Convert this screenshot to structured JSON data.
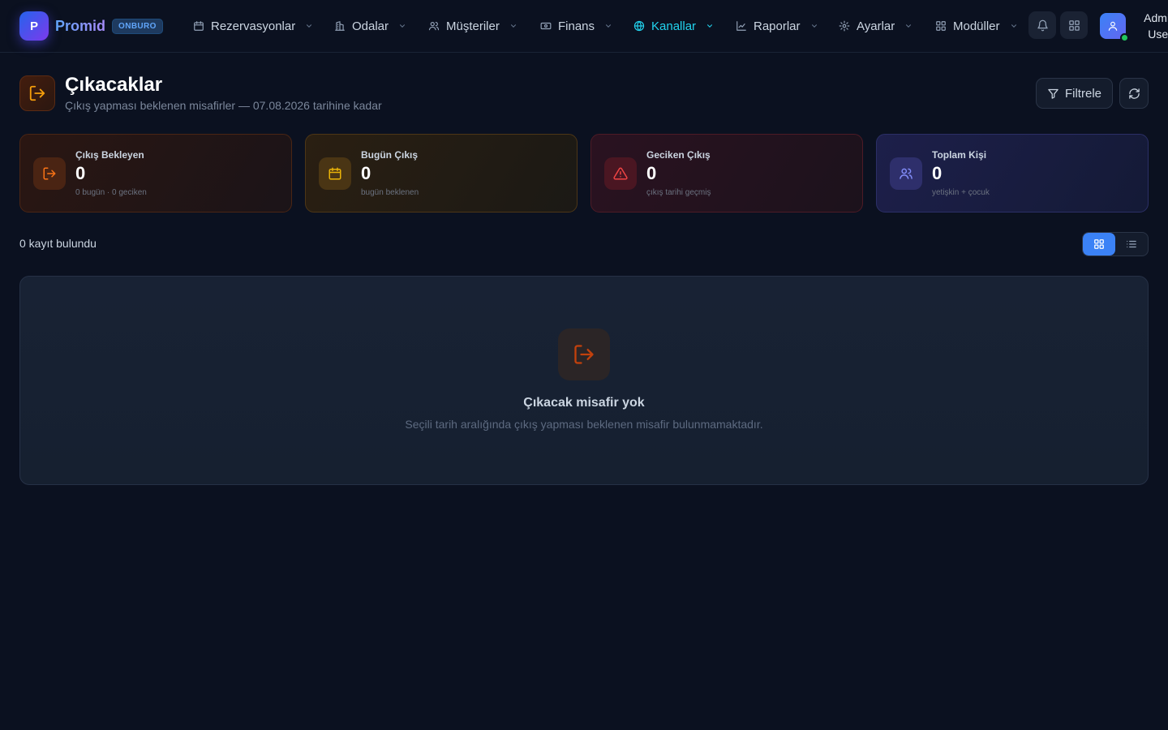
{
  "brand": {
    "logo_letter": "P",
    "name": "Promid",
    "badge": "ONBURO"
  },
  "nav": [
    {
      "label": "Rezervasyonlar",
      "icon": "calendar-icon",
      "active": false
    },
    {
      "label": "Odalar",
      "icon": "building-icon",
      "active": false
    },
    {
      "label": "Müşteriler",
      "icon": "users-icon",
      "active": false
    },
    {
      "label": "Finans",
      "icon": "banknote-icon",
      "active": false
    },
    {
      "label": "Kanallar",
      "icon": "globe-icon",
      "active": true
    },
    {
      "label": "Raporlar",
      "icon": "chart-icon",
      "active": false
    },
    {
      "label": "Ayarlar",
      "icon": "gear-icon",
      "active": false
    },
    {
      "label": "Modüller",
      "icon": "grid-icon",
      "active": false
    }
  ],
  "user": {
    "name": "Admin User",
    "online": true
  },
  "page": {
    "title": "Çıkacaklar",
    "subtitle": "Çıkış yapması beklenen misafirler — 07.08.2026 tarihine kadar",
    "filter_label": "Filtrele"
  },
  "stats": [
    {
      "label": "Çıkış Bekleyen",
      "value": "0",
      "sub": "0 bugün · 0 geciken",
      "icon": "logout-icon"
    },
    {
      "label": "Bugün Çıkış",
      "value": "0",
      "sub": "bugün beklenen",
      "icon": "calendar-icon"
    },
    {
      "label": "Geciken Çıkış",
      "value": "0",
      "sub": "çıkış tarihi geçmiş",
      "icon": "warning-icon"
    },
    {
      "label": "Toplam Kişi",
      "value": "0",
      "sub": "yetişkin + çocuk",
      "icon": "users-icon"
    }
  ],
  "results": {
    "count_text": "0 kayıt bulundu",
    "view_mode": "grid"
  },
  "empty": {
    "title": "Çıkacak misafir yok",
    "description": "Seçili tarih aralığında çıkış yapması beklenen misafir bulunmamaktadır."
  },
  "colors": {
    "background": "#0b1120",
    "accent_active_nav": "#22d3ee",
    "primary": "#3b82f6",
    "orange": "#f97316",
    "amber": "#eab308",
    "red": "#ef4444",
    "indigo": "#818cf8",
    "online": "#22c55e"
  }
}
